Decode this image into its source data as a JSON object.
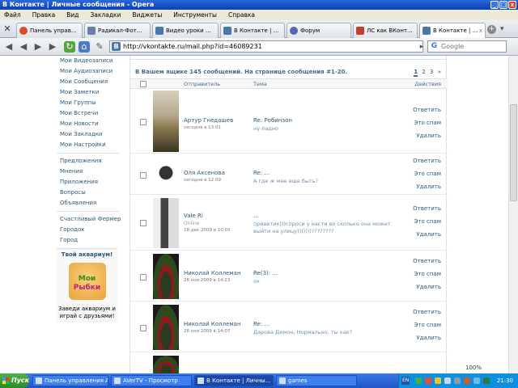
{
  "window": {
    "title": "В Контакте | Личные сообщения - Opera",
    "min_icon": "minimize-icon",
    "max_icon": "maximize-icon",
    "close_icon": "close-icon",
    "min_glyph": "_",
    "max_glyph": "□",
    "close_glyph": "x"
  },
  "menu": [
    "Файл",
    "Правка",
    "Вид",
    "Закладки",
    "Виджеты",
    "Инструменты",
    "Справка"
  ],
  "tabs": [
    {
      "label": "Панель управ...",
      "icon": "opera-icon",
      "color": "#d94b2b",
      "active": false
    },
    {
      "label": "Радикал-Фот...",
      "icon": "radikal-icon",
      "color": "#6a7fa5",
      "active": false
    },
    {
      "label": "Видео уроки ...",
      "icon": "video-icon",
      "color": "#4a76a8",
      "active": false
    },
    {
      "label": "В Контакте | ...",
      "icon": "vk-icon",
      "color": "#4a76a8",
      "active": false
    },
    {
      "label": "Форум",
      "icon": "forum-icon",
      "color": "#5866b8",
      "active": false
    },
    {
      "label": "ЛС как ВКонт...",
      "icon": "site-icon",
      "color": "#c43f2b",
      "active": false
    },
    {
      "label": "В Контакте | ...",
      "icon": "vk-icon",
      "color": "#4a76a8",
      "active": true
    }
  ],
  "tab_close_glyph": "x",
  "tab_add_glyph": "+",
  "tab_menu_glyph": "▾",
  "address": {
    "url": "http://vkontakte.ru/mail.php?id=46089231",
    "search_placeholder": "Google",
    "back_glyph": "◀",
    "forward_glyph": "▶",
    "reload_glyph": "↻",
    "home_glyph": "⌂",
    "edit_glyph": "✎",
    "fav_glyph": "B",
    "go_glyph": "▸",
    "google_glyph": "G"
  },
  "leftnav": {
    "group1": [
      "Мои Видеозаписи",
      "Мои Аудиозаписи",
      "Мои Сообщения",
      "Мои Заметки",
      "Мои Группы",
      "Мои Встречи",
      "Мои Новости",
      "Мои Закладки",
      "Мои Настройки"
    ],
    "group2": [
      "Предложения",
      "Мнения",
      "Приложения",
      "Вопросы",
      "Объявления"
    ],
    "group3": [
      "Счастливый Фермер",
      "Городок",
      "Город"
    ],
    "promo_title": "Твой аквариум!",
    "promo_logo_1": "Мои",
    "promo_logo_2": "Рыбки",
    "promo_text": "Заведи аквариум и играй с друзьями!"
  },
  "mail": {
    "summary": "В Вашем ящике 145 сообщений. На странице сообщения #1-20.",
    "pages": [
      "1",
      "2",
      "3",
      "»"
    ],
    "current_page": "1",
    "col_sender": "Отправитель",
    "col_subject": "Тема",
    "col_actions": "Действия",
    "actions": [
      "Ответить",
      "Это спам",
      "Удалить"
    ],
    "messages": [
      {
        "name": "Артур Гнедашев",
        "status": "",
        "date": "сегодня в 13:01",
        "subject": "Re: Робинзон",
        "preview": "ну ладно"
      },
      {
        "name": "Оля Аксенова",
        "status": "",
        "date": "сегодня в 12:09",
        "subject": "Re: ...",
        "preview": "А где ж мне еще быть?"
      },
      {
        "name": "Vale Ri",
        "status": "Online",
        "date": "18 дек 2009 в 10:05",
        "subject": "...",
        "preview": "приветик)))спроси у насти во сколько она может выйти на улицу)))))))????????"
      },
      {
        "name": "Николай Коллеман",
        "status": "",
        "date": "26 ноя 2009 в 14:23",
        "subject": "Re(3): ...",
        "preview": "ок"
      },
      {
        "name": "Николай Коллеман",
        "status": "",
        "date": "26 ноя 2009 в 14:07",
        "subject": "Re: ...",
        "preview": "Дарова Димон, Нормально, ты как?"
      }
    ]
  },
  "zoom": "100%",
  "taskbar": {
    "start": "Пуск",
    "tasks": [
      "Панель управления AV...",
      "AVerTV - Просмотр",
      "В Контакте | Личны...",
      "games"
    ],
    "active_task": "В Контакте | Личны...",
    "lang": "EN",
    "clock": "21:30"
  }
}
